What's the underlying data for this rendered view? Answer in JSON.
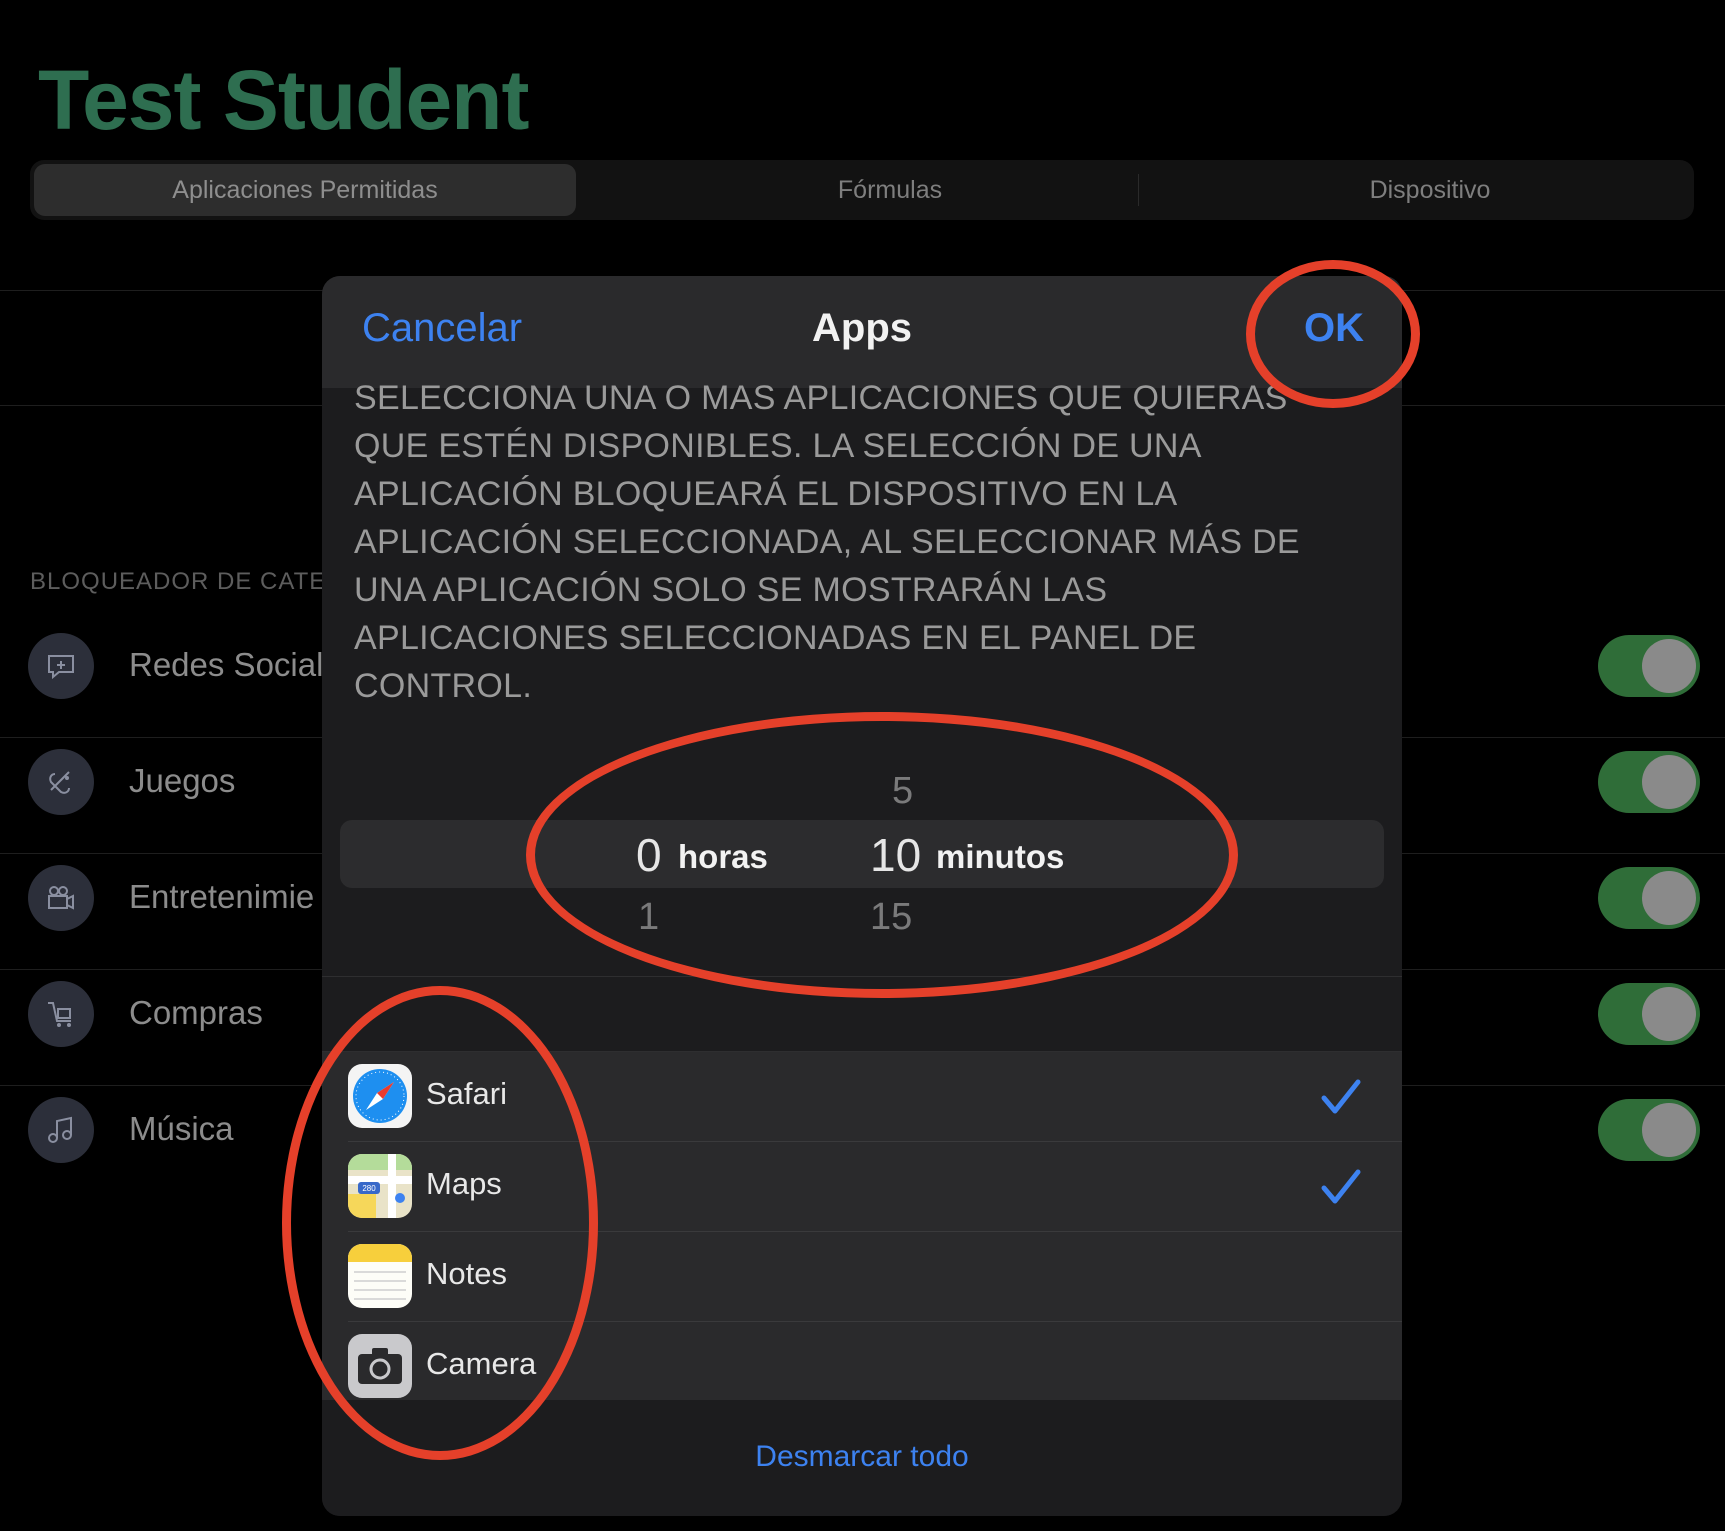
{
  "page": {
    "title": "Test Student"
  },
  "tabs": [
    {
      "label": "Aplicaciones Permitidas",
      "selected": true
    },
    {
      "label": "Fórmulas",
      "selected": false
    },
    {
      "label": "Dispositivo",
      "selected": false
    }
  ],
  "categories": {
    "header": "BLOQUEADOR DE CATE",
    "items": [
      {
        "label": "Redes Social",
        "icon": "chat-bubble-icon",
        "enabled": true
      },
      {
        "label": "Juegos",
        "icon": "game-controller-icon",
        "enabled": true
      },
      {
        "label": "Entretenimie",
        "icon": "video-camera-icon",
        "enabled": true
      },
      {
        "label": "Compras",
        "icon": "shopping-cart-icon",
        "enabled": true
      },
      {
        "label": "Música",
        "icon": "music-note-icon",
        "enabled": true
      }
    ]
  },
  "modal": {
    "cancel_label": "Cancelar",
    "title": "Apps",
    "ok_label": "OK",
    "instructions": "SELECCIONA UNA O MAS APLICACIONES QUE QUIERAS QUE ESTÉN DISPONIBLES. LA SELECCIÓN DE UNA APLICACIÓN BLOQUEARÁ EL DISPOSITIVO EN LA APLICACIÓN SELECCIONADA, AL SELECCIONAR MÁS DE UNA APLICACIÓN SOLO SE MOSTRARÁN LAS APLICACIONES SELECCIONADAS EN EL PANEL DE CONTROL.",
    "picker": {
      "hours": {
        "selected": "0",
        "below": "1",
        "unit": "horas"
      },
      "minutes": {
        "above": "5",
        "selected": "10",
        "below": "15",
        "unit": "minutos"
      }
    },
    "apps": [
      {
        "name": "Safari",
        "icon": "safari-icon",
        "checked": true
      },
      {
        "name": "Maps",
        "icon": "maps-icon",
        "checked": true
      },
      {
        "name": "Notes",
        "icon": "notes-icon",
        "checked": false
      },
      {
        "name": "Camera",
        "icon": "camera-icon",
        "checked": false
      }
    ],
    "uncheck_all_label": "Desmarcar todo"
  },
  "colors": {
    "accent": "#3d82f0",
    "title_green": "#2e6e50",
    "toggle_on": "#2f6d38",
    "annotation_red": "#e5402a"
  }
}
